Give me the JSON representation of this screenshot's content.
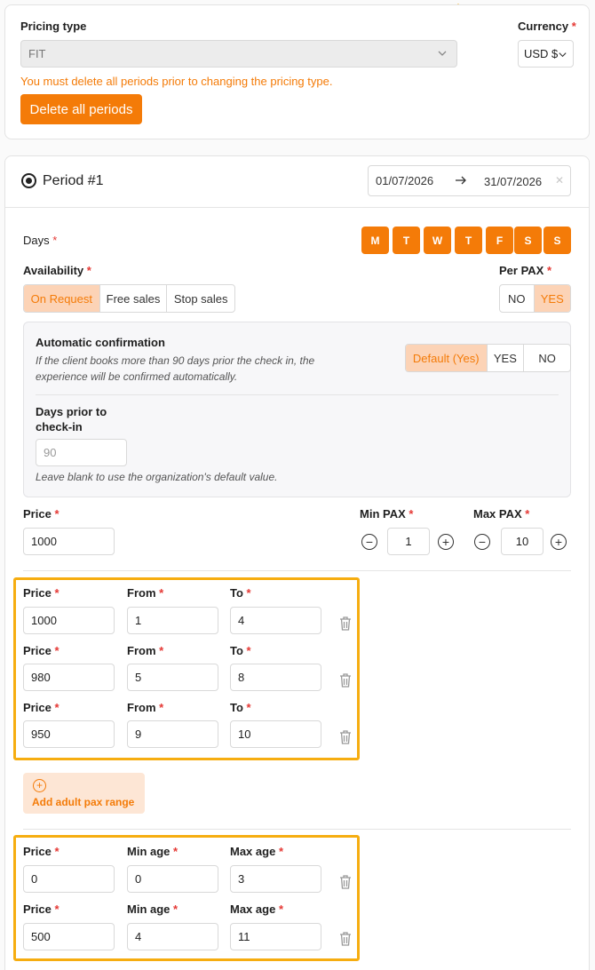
{
  "pricing_type": {
    "label": "Pricing type",
    "value": "FIT",
    "warning": "You must delete all periods prior to changing the pricing type.",
    "delete_button": "Delete all periods"
  },
  "currency": {
    "label": "Currency",
    "required": "*",
    "value": "USD $"
  },
  "period": {
    "title": "Period #1",
    "start_date": "01/07/2026",
    "end_date": "31/07/2026",
    "days_label": "Days",
    "days": [
      "M",
      "T",
      "W",
      "T",
      "F",
      "S",
      "S"
    ],
    "availability_label": "Availability",
    "availability_options": [
      "On Request",
      "Free sales",
      "Stop sales"
    ],
    "per_pax_label": "Per PAX",
    "per_pax_options": [
      "NO",
      "YES"
    ],
    "auto_confirm": {
      "title": "Automatic confirmation",
      "description": "If the client books more than 90 days prior the check in, the experience will be confirmed automatically.",
      "options": [
        "Default (Yes)",
        "YES",
        "NO"
      ],
      "days_prior_label_1": "Days prior to",
      "days_prior_label_2": "check-in",
      "days_prior_placeholder": "90",
      "hint": "Leave blank to use the organization's default value."
    },
    "price_label": "Price",
    "price_value": "1000",
    "min_pax_label": "Min PAX",
    "min_pax_value": "1",
    "max_pax_label": "Max PAX",
    "max_pax_value": "10"
  },
  "adult_ranges": {
    "labels": {
      "price": "Price",
      "from": "From",
      "to": "To"
    },
    "rows": [
      {
        "price": "1000",
        "from": "1",
        "to": "4"
      },
      {
        "price": "980",
        "from": "5",
        "to": "8"
      },
      {
        "price": "950",
        "from": "9",
        "to": "10"
      }
    ],
    "add_label": "Add adult pax range"
  },
  "child_ranges": {
    "labels": {
      "price": "Price",
      "min_age": "Min age",
      "max_age": "Max age"
    },
    "rows": [
      {
        "price": "0",
        "min_age": "0",
        "max_age": "3"
      },
      {
        "price": "500",
        "min_age": "4",
        "max_age": "11"
      }
    ]
  },
  "colors": {
    "accent": "#f47b08",
    "accent_light": "#fcd3b6",
    "highlight": "#f6ad10",
    "required": "#e53935"
  }
}
